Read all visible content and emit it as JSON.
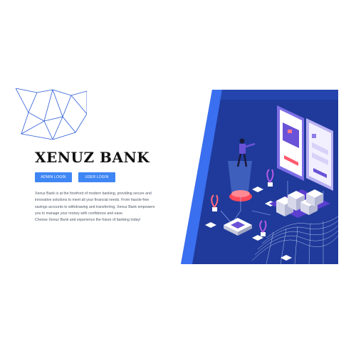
{
  "brand": {
    "title": "XENUZ BANK"
  },
  "actions": {
    "admin_login_label": "ADMIN LOGIN",
    "user_login_label": "USER LOGIN"
  },
  "description": {
    "lines": [
      "Xenuz Bank is at the forefront of modern banking, providing secure and",
      "innovative solutions to meet all your financial needs. From hassle-free",
      "savings accounts to withdrawing and transferring, Xenuz Bank empowers",
      "you to manage your money with confidence and ease.",
      "Choose Xenuz Bank and experience the future of banking today!"
    ]
  },
  "colors": {
    "primary_button": "#3f86f5",
    "hero_background": "#1f3a9a",
    "hero_accent": "#3a6ff0",
    "mesh_line": "#2a5bd7"
  }
}
